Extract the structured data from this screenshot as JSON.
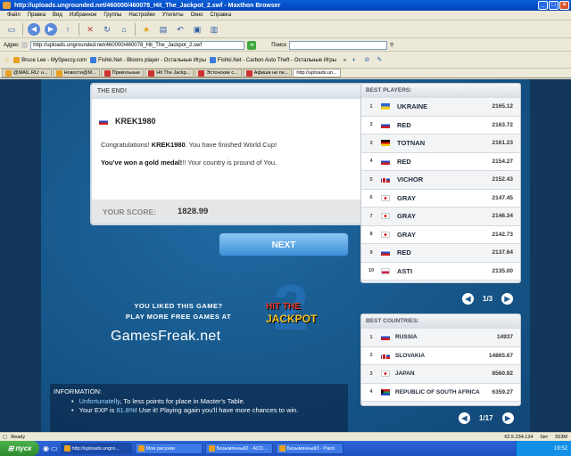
{
  "window": {
    "title": "http://uploads.ungrounded.net/460000/460078_Hit_The_Jackpot_2.swf - Maxthon Browser"
  },
  "menu": [
    "Файл",
    "Правка",
    "Вид",
    "Избранное",
    "Группы",
    "Настройки",
    "Утилиты",
    "Окно",
    "Справка"
  ],
  "address": {
    "label": "Адрес",
    "url": "http://uploads.ungrounded.net/460000/460078_Hit_The_Jackpot_2.swf",
    "search_label": "Поиск"
  },
  "links": [
    "Bruce Lee - MySpeccy.com",
    "Fishki.Net - Bloons player - Остальные Игры",
    "Fishki.Net - Carbon Auto Theft - Остальные Игры"
  ],
  "tabs": [
    "@MAIL.RU: н...",
    "Новости@M...",
    "Прикольные",
    "Hit The Jackp...",
    "Эстонские с...",
    "Афиши не пе...",
    "http://uploads.un..."
  ],
  "game": {
    "end_header": "THE END!",
    "player_name": "KREK1980",
    "congrats_pre": "Congratulations! ",
    "congrats_name": "KREK1980",
    "congrats_post": ". You have finished World Cup!",
    "medal_strong": "You've won a gold medal!",
    "medal_rest": "!! Your country is pround of You.",
    "score_label": "YOUR SCORE:",
    "score_value": "1828.99",
    "next_label": "NEXT",
    "best_players_header": "BEST PLAYERS:",
    "players": [
      {
        "rank": "1",
        "flag": "ua",
        "name": "UKRAINE",
        "score": "2165.12"
      },
      {
        "rank": "2",
        "flag": "ru",
        "name": "RED",
        "score": "2163.72"
      },
      {
        "rank": "3",
        "flag": "de",
        "name": "TOTNAN",
        "score": "2161.23"
      },
      {
        "rank": "4",
        "flag": "ru",
        "name": "RED",
        "score": "2154.27"
      },
      {
        "rank": "5",
        "flag": "sk",
        "name": "VICHOR",
        "score": "2152.43"
      },
      {
        "rank": "6",
        "flag": "jp",
        "name": "GRAY",
        "score": "2147.45"
      },
      {
        "rank": "7",
        "flag": "jp",
        "name": "GRAY",
        "score": "2146.34"
      },
      {
        "rank": "8",
        "flag": "jp",
        "name": "GRAY",
        "score": "2142.73"
      },
      {
        "rank": "9",
        "flag": "ru",
        "name": "RED",
        "score": "2137.64"
      },
      {
        "rank": "10",
        "flag": "pl",
        "name": "ASTI",
        "score": "2135.00"
      }
    ],
    "players_page": "1/3",
    "best_countries_header": "BEST COUNTRIES:",
    "countries": [
      {
        "rank": "1",
        "flag": "ru",
        "name": "RUSSIA",
        "score": "14937"
      },
      {
        "rank": "2",
        "flag": "sk",
        "name": "SLOVAKIA",
        "score": "14865.67"
      },
      {
        "rank": "3",
        "flag": "jp",
        "name": "JAPAN",
        "score": "8560.92"
      },
      {
        "rank": "4",
        "flag": "za",
        "name": "REPUBLIC OF SOUTH AFRICA",
        "score": "6359.27"
      }
    ],
    "countries_page": "1/17",
    "promo_line1": "YOU LIKED THIS GAME?",
    "promo_line2": "PLAY MORE FREE GAMES AT",
    "promo_site": "GamesFreak.net",
    "jackpot_hit": "HIT THE",
    "jackpot_word": "JACKPOT",
    "jackpot_num": "2",
    "info_header": "INFORMATION:",
    "info_line1_hl": "Unfortunatelly",
    "info_line1_rest": ", To less points for place in Master's Table.",
    "info_line2_a": "Your EXP is ",
    "info_line2_hl": "81.8%",
    "info_line2_b": "! Use it! Playing again you'll have more chances to win."
  },
  "status": {
    "text": "Ready",
    "coords": "62.5.234.124",
    "lang": "бит",
    "mem": "553M"
  },
  "taskbar": {
    "start": "пуск",
    "items": [
      "http://uploads.ungro...",
      "Мои рисунки",
      "Безымянный2 - ACD...",
      "Безымянный3 - Paint"
    ],
    "clock": "19:52"
  }
}
